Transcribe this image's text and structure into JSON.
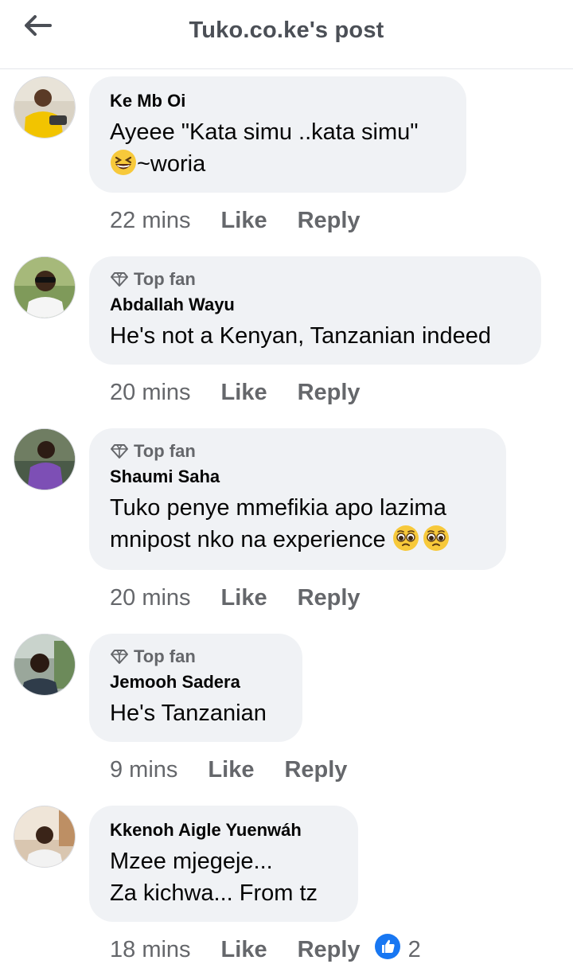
{
  "header": {
    "back_icon": "arrow-left-icon",
    "title": "Tuko.co.ke's post"
  },
  "comments": [
    {
      "author": "Ke Mb Oi",
      "top_fan": false,
      "lines": [
        "Ayeee \"Kata simu ..kata simu\"",
        "~woria"
      ],
      "emoji_line2_prefix": "grinning-squinting-face-emoji",
      "time": "22 mins",
      "like": "Like",
      "reply": "Reply"
    },
    {
      "author": "Abdallah Wayu",
      "top_fan": true,
      "top_fan_label": "Top fan",
      "lines": [
        "He's not a Kenyan, Tanzanian indeed"
      ],
      "time": "20 mins",
      "like": "Like",
      "reply": "Reply"
    },
    {
      "author": "Shaumi Saha",
      "top_fan": true,
      "top_fan_label": "Top fan",
      "lines": [
        "Tuko penye mmefikia apo lazima",
        "mnipost nko na experience"
      ],
      "emoji_line2_suffix": "pleading-face-emoji x2",
      "time": "20 mins",
      "like": "Like",
      "reply": "Reply"
    },
    {
      "author": "Jemooh Sadera",
      "top_fan": true,
      "top_fan_label": "Top fan",
      "lines": [
        "He's Tanzanian"
      ],
      "time": "9 mins",
      "like": "Like",
      "reply": "Reply"
    },
    {
      "author": "Kkenoh Aigle Yuenwáh",
      "top_fan": false,
      "lines": [
        "Mzee mjegeje...",
        "Za kichwa... From tz"
      ],
      "time": "18 mins",
      "like": "Like",
      "reply": "Reply",
      "reaction_icon": "like-reaction-icon",
      "reaction_count": "2"
    }
  ],
  "colors": {
    "bubble": "#f0f2f5",
    "meta_text": "#65676b",
    "like_blue": "#1877f2"
  }
}
